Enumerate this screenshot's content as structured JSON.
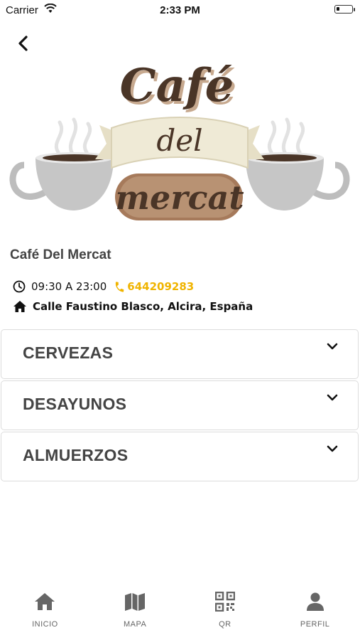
{
  "status_bar": {
    "carrier": "Carrier",
    "time": "2:33 PM"
  },
  "cafe": {
    "name": "Café Del Mercat",
    "hours": "09:30 A 23:00",
    "phone": "644209283",
    "address": "Calle Faustino Blasco, Alcira, España"
  },
  "logo": {
    "line1": "Café",
    "line2": "del",
    "line3": "mercat"
  },
  "menu_sections": [
    {
      "label": "CERVEZAS"
    },
    {
      "label": "DESAYUNOS"
    },
    {
      "label": "ALMUERZOS"
    }
  ],
  "tabs": [
    {
      "label": "INICIO",
      "icon": "home-icon"
    },
    {
      "label": "MAPA",
      "icon": "map-icon"
    },
    {
      "label": "QR",
      "icon": "qr-code-icon"
    },
    {
      "label": "PERFIL",
      "icon": "user-icon"
    }
  ],
  "colors": {
    "accent": "#f0b400",
    "coffee": "#4a3527",
    "cup": "#c9c9c9"
  }
}
